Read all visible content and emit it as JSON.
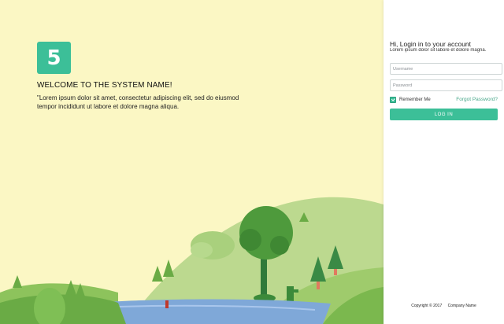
{
  "brand": {
    "logo_text": "5",
    "color": "#3cbf98"
  },
  "hero": {
    "title": "WELCOME TO THE SYSTEM NAME!",
    "description": "\"Lorem ipsum dolor sit amet, consectetur adipiscing elit, sed do eiusmod tempor incididunt ut labore et dolore magna aliqua."
  },
  "login": {
    "title": "Hi, Login in to your account",
    "subtitle": "Lorem ipsum dolor sit labore et dolore magna.",
    "username_placeholder": "Username",
    "password_placeholder": "Password",
    "remember_label": "Remember Me",
    "remember_checked": true,
    "forgot_label": "Forgot Password?",
    "button_label": "LOG IN"
  },
  "footer": {
    "copyright": "Copyright © 2017",
    "company": "Company Name"
  }
}
